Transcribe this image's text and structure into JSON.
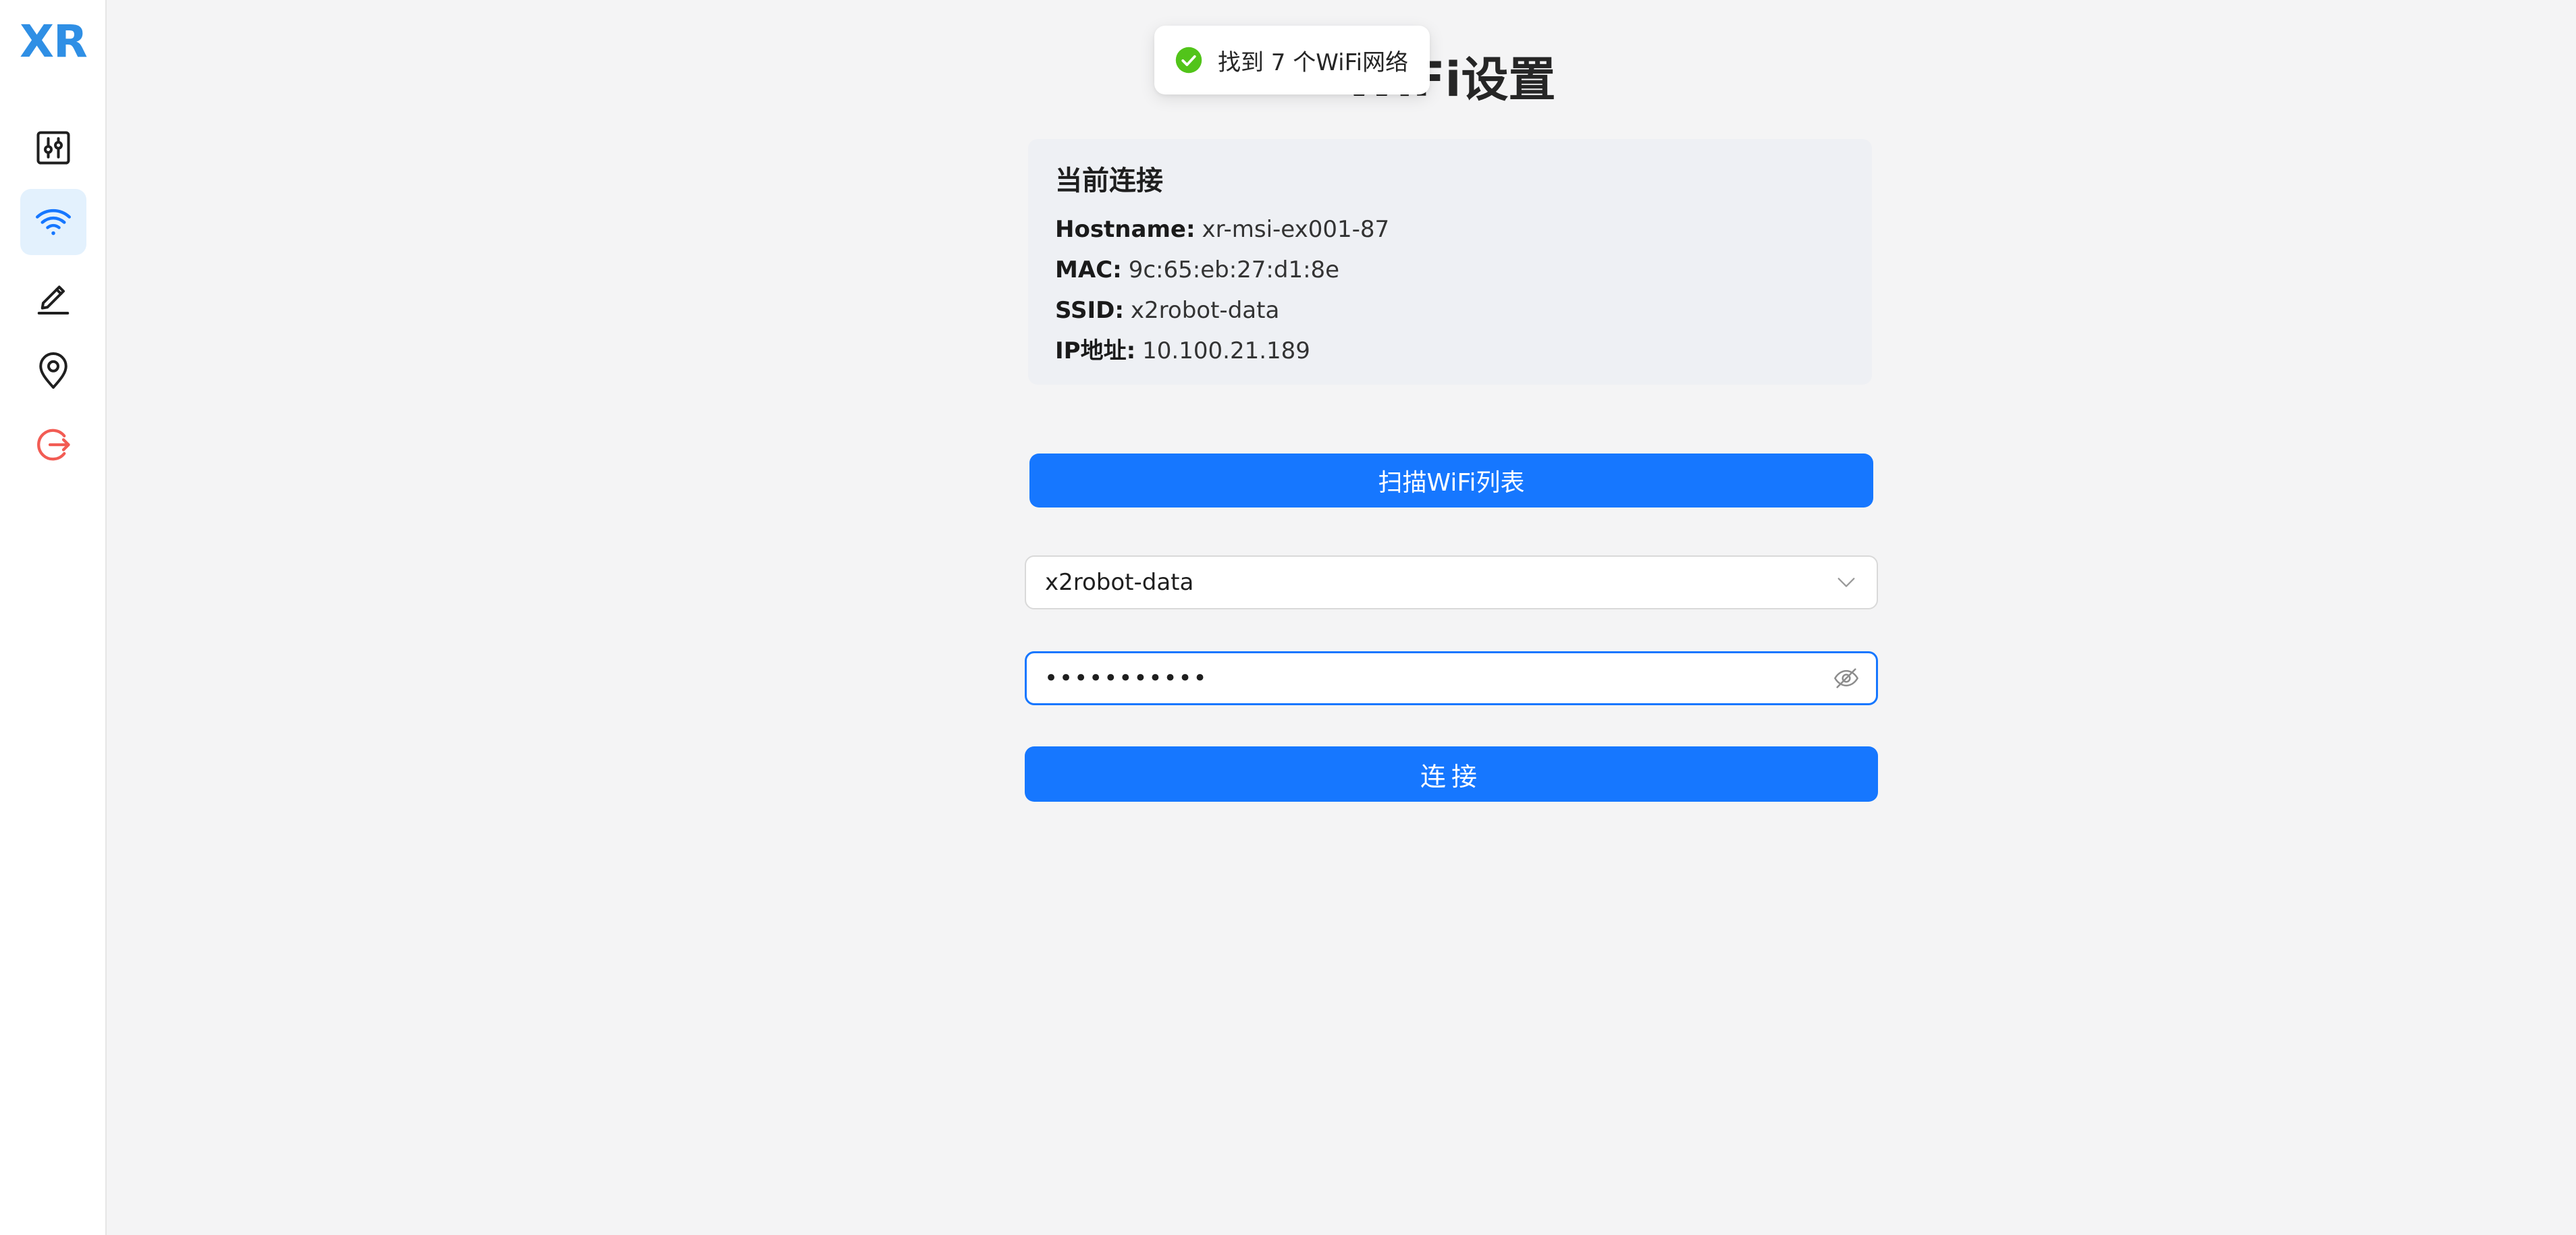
{
  "app": {
    "logo": "XR",
    "accent_color": "#1677ff",
    "logo_color": "#2f8fe5"
  },
  "sidebar": {
    "items": [
      {
        "name": "settings-sliders",
        "icon": "sliders-icon",
        "active": false
      },
      {
        "name": "wifi",
        "icon": "wifi-icon",
        "active": true
      },
      {
        "name": "edit",
        "icon": "pen-icon",
        "active": false
      },
      {
        "name": "location",
        "icon": "location-pin-icon",
        "active": false
      },
      {
        "name": "logout",
        "icon": "logout-icon",
        "active": false,
        "color": "#f25c54"
      }
    ]
  },
  "page": {
    "title": "WiFi设置"
  },
  "toast": {
    "icon": "check-circle-icon",
    "color": "#52c41a",
    "message": "找到 7 个WiFi网络"
  },
  "current_connection": {
    "title": "当前连接",
    "rows": [
      {
        "label": "Hostname:",
        "value": "xr-msi-ex001-87"
      },
      {
        "label": "MAC:",
        "value": "9c:65:eb:27:d1:8e"
      },
      {
        "label": "SSID:",
        "value": "x2robot-data"
      },
      {
        "label": "IP地址:",
        "value": "10.100.21.189"
      }
    ]
  },
  "scan_button": {
    "label": "扫描WiFi列表"
  },
  "ssid_select": {
    "value": "x2robot-data"
  },
  "password_field": {
    "value": "x2robot1234"
  },
  "connect_button": {
    "label": "连接"
  }
}
